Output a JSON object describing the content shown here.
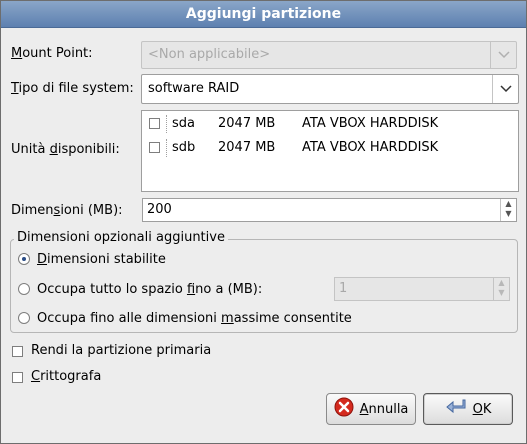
{
  "dialog": {
    "title": "Aggiungi partizione"
  },
  "mount_point": {
    "label_pre": "",
    "label_u": "M",
    "label_post": "ount Point:",
    "value": "<Non applicabile>",
    "disabled": true
  },
  "fs_type": {
    "label_pre": "",
    "label_u": "T",
    "label_post": "ipo di file system:",
    "value": "software RAID"
  },
  "drives": {
    "label_pre": "Unità ",
    "label_u": "d",
    "label_post": "isponibili:",
    "rows": [
      {
        "name": "sda",
        "size": "2047 MB",
        "model": "ATA VBOX HARDDISK",
        "checked": false
      },
      {
        "name": "sdb",
        "size": "2047 MB",
        "model": "ATA VBOX HARDDISK",
        "checked": false
      }
    ]
  },
  "size": {
    "label_pre": "Dimen",
    "label_u": "s",
    "label_post": "ioni (MB):",
    "value": "200"
  },
  "optional": {
    "title": "Dimensioni opzionali aggiuntive",
    "fixed": {
      "label_pre": "",
      "label_u": "D",
      "label_post": "imensioni stabilite",
      "selected": true
    },
    "fill_upto": {
      "label_pre": "Occupa tutto lo spazio ",
      "label_u": "f",
      "label_post": "ino a (MB):",
      "selected": false,
      "value": "1"
    },
    "fill_max": {
      "label_pre": "Occupa fino alle dimensioni ",
      "label_u": "m",
      "label_post": "assime consentite",
      "selected": false
    }
  },
  "primary": {
    "label": "Rendi la partizione primaria",
    "checked": false
  },
  "encrypt": {
    "label_pre": "",
    "label_u": "C",
    "label_post": "rittografa",
    "checked": false
  },
  "buttons": {
    "cancel": {
      "label_pre": "",
      "label_u": "A",
      "label_post": "nnulla",
      "icon": "cancel-icon"
    },
    "ok": {
      "label_pre": "",
      "label_u": "O",
      "label_post": "K",
      "icon": "ok-arrow-icon"
    }
  }
}
